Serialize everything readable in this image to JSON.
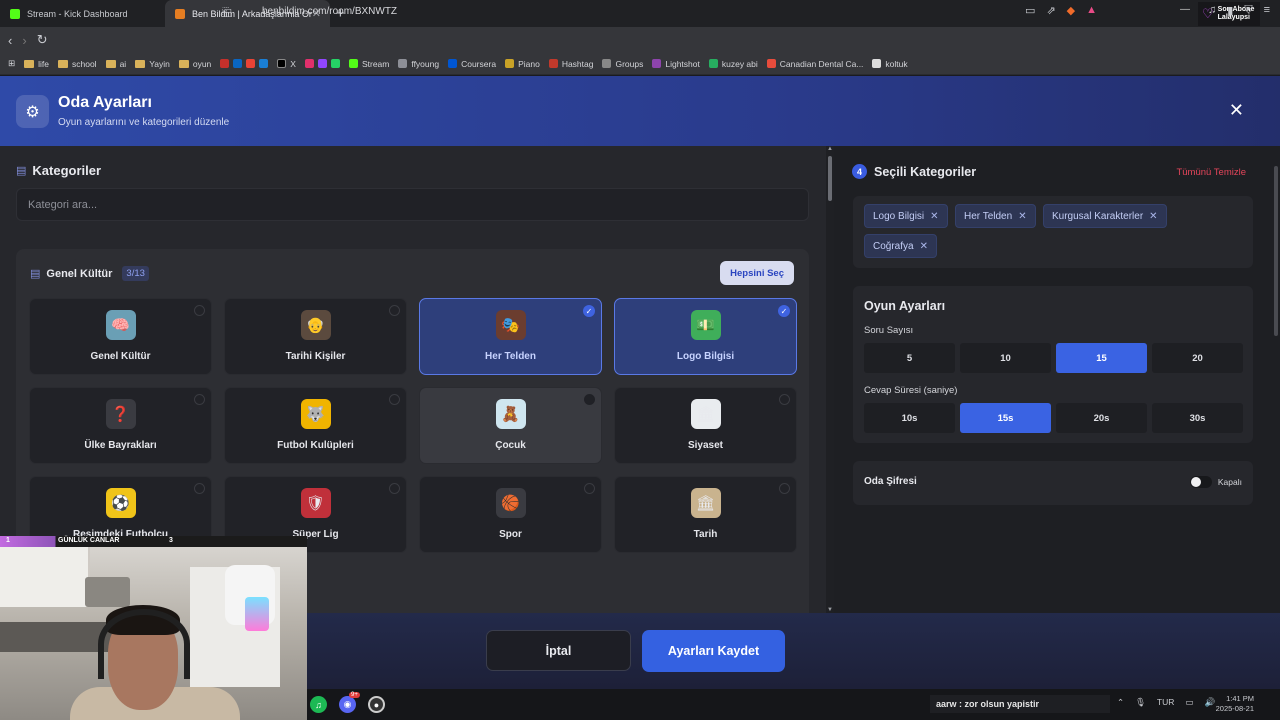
{
  "browser": {
    "tabs": [
      {
        "title": "Stream - Kick Dashboard",
        "active": false,
        "favicon_color": "#53fc18"
      },
      {
        "title": "Ben Bildim | Arkadaşlarınla Onlin",
        "active": true,
        "favicon_color": "#e67e22"
      }
    ],
    "url": "benbildim.com/room/BXNWTZ",
    "extension_badge": {
      "line1": "Son Abone",
      "line2": "Lalayupsi"
    },
    "bookmarks": [
      "life",
      "school",
      "ai",
      "Yayin",
      "oyun",
      "X",
      "Stream",
      "ffyoung",
      "Coursera",
      "Piano",
      "Hashtag",
      "Groups",
      "Lightshot",
      "kuzey abi",
      "Canadian Dental Ca...",
      "koltuk"
    ]
  },
  "modal": {
    "title": "Oda Ayarları",
    "subtitle": "Oyun ayarlarını ve kategorileri düzenle",
    "close_icon": "✕"
  },
  "categories_panel": {
    "title": "Kategoriler",
    "search_placeholder": "Kategori ara...",
    "group": {
      "name": "Genel Kültür",
      "count": "3/13",
      "select_all": "Hepsini Seç",
      "cards": [
        {
          "label": "Genel Kültür",
          "selected": false,
          "icon": "🧠",
          "icon_bg": "#6a9fb5"
        },
        {
          "label": "Tarihi Kişiler",
          "selected": false,
          "icon": "👴",
          "icon_bg": "#5b4a3e"
        },
        {
          "label": "Her Telden",
          "selected": true,
          "icon": "🎭",
          "icon_bg": "#6b3d2f"
        },
        {
          "label": "Logo Bilgisi",
          "selected": true,
          "icon": "💵",
          "icon_bg": "#3fae5a"
        },
        {
          "label": "Ülke Bayrakları",
          "selected": false,
          "icon": "❓",
          "icon_bg": "#3a3b41"
        },
        {
          "label": "Futbol Kulüpleri",
          "selected": false,
          "icon": "🐺",
          "icon_bg": "#f0b400"
        },
        {
          "label": "Çocuk",
          "selected": false,
          "hover": true,
          "icon": "🧸",
          "icon_bg": "#cfe6f0"
        },
        {
          "label": "Siyaset",
          "selected": false,
          "icon": "🏛",
          "icon_bg": "#e9ecef"
        },
        {
          "label": "Resimdeki Futbolcu",
          "selected": false,
          "icon": "⚽",
          "icon_bg": "#f0c419"
        },
        {
          "label": "Süper Lig",
          "selected": false,
          "icon": "🛡",
          "icon_bg": "#c0303a"
        },
        {
          "label": "Spor",
          "selected": false,
          "icon": "🏀",
          "icon_bg": "#3a3b41"
        },
        {
          "label": "Tarih",
          "selected": false,
          "icon": "🏛",
          "icon_bg": "#c9b38e"
        }
      ]
    }
  },
  "selected_panel": {
    "count": "4",
    "title": "Seçili Kategoriler",
    "clear_all": "Tümünü Temizle",
    "chips": [
      "Logo Bilgisi",
      "Her Telden",
      "Kurgusal Karakterler",
      "Coğrafya"
    ]
  },
  "game_settings": {
    "title": "Oyun Ayarları",
    "question_count_label": "Soru Sayısı",
    "question_options": [
      "5",
      "10",
      "15",
      "20"
    ],
    "question_selected": "15",
    "answer_time_label": "Cevap Süresi (saniye)",
    "time_options": [
      "10s",
      "15s",
      "20s",
      "30s"
    ],
    "time_selected": "15s"
  },
  "room_password": {
    "label": "Oda Şifresi",
    "state": "Kapalı",
    "enabled": false
  },
  "footer": {
    "cancel": "İptal",
    "save": "Ayarları Kaydet"
  },
  "stream_overlay": {
    "rank": "1",
    "label": "GÜNLÜK CANLAR",
    "value": "3"
  },
  "taskbar": {
    "chat_message": "aarw : zor olsun yapistir",
    "language": "TUR",
    "time": "1:41 PM",
    "date": "2025-08-21",
    "discord_badge": "9+"
  }
}
